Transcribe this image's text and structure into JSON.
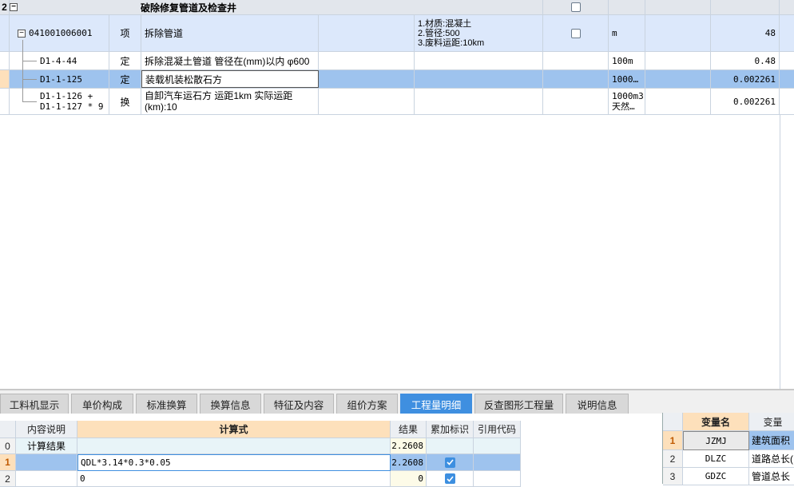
{
  "top_grid": {
    "header_row": {
      "row_number": "2",
      "toggle": "−",
      "title": "破除修复管道及检查井"
    },
    "item_row": {
      "toggle": "−",
      "code": "041001006001",
      "type": "项",
      "name": "拆除管道",
      "features": [
        "1.材质:混凝土",
        "2.管径:500",
        "3.废料运距:10km"
      ],
      "unit": "m",
      "quantity": "48"
    },
    "sub_rows": [
      {
        "code": "D1-4-44",
        "type": "定",
        "name": "拆除混凝土管道 管径在(mm)以内 φ600",
        "unit": "100m",
        "quantity": "0.48"
      },
      {
        "code": "D1-1-125",
        "type": "定",
        "name": "装载机装松散石方",
        "unit": "1000…",
        "quantity": "0.002261"
      },
      {
        "code_line1": "D1-1-126 +",
        "code_line2": "D1-1-127 * 9",
        "type": "换",
        "name_line1": "自卸汽车运石方 运距1km  实际运距",
        "name_line2": "(km):10",
        "unit_line1": "1000m3",
        "unit_line2": "天然…",
        "quantity": "0.002261"
      }
    ]
  },
  "tabs": [
    {
      "label": "工料机显示"
    },
    {
      "label": "单价构成"
    },
    {
      "label": "标准换算"
    },
    {
      "label": "换算信息"
    },
    {
      "label": "特征及内容"
    },
    {
      "label": "组价方案"
    },
    {
      "label": "工程量明细"
    },
    {
      "label": "反查图形工程量"
    },
    {
      "label": "说明信息"
    }
  ],
  "detail_grid": {
    "headers": {
      "description": "内容说明",
      "formula": "计算式",
      "result": "结果",
      "accumulate": "累加标识",
      "ref_code": "引用代码"
    },
    "rows": [
      {
        "num": "0",
        "description": "计算结果",
        "formula": "",
        "result": "2.2608"
      },
      {
        "num": "1",
        "description": "",
        "formula": "QDL*3.14*0.3*0.05",
        "result": "2.2608",
        "checked": true
      },
      {
        "num": "2",
        "description": "",
        "formula": "0",
        "result": "0",
        "checked": true
      }
    ]
  },
  "variable_grid": {
    "headers": {
      "name": "变量名",
      "desc": "变量"
    },
    "rows": [
      {
        "num": "1",
        "name": "JZMJ",
        "desc": "建筑面积"
      },
      {
        "num": "2",
        "name": "DLZC",
        "desc": "道路总长("
      },
      {
        "num": "3",
        "name": "GDZC",
        "desc": "管道总长"
      }
    ]
  },
  "colors": {
    "accent": "#3f8fe0",
    "selected_row": "#9ec3ee",
    "item_row": "#dce8fb",
    "header_orange": "#fde0bb"
  }
}
